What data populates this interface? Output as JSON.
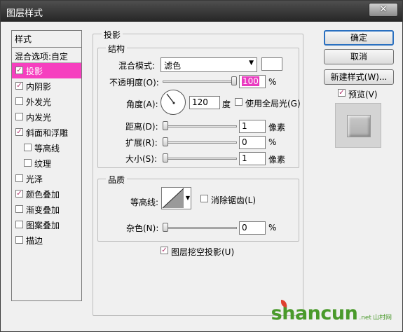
{
  "window": {
    "title": "图层样式",
    "close_glyph": "✕"
  },
  "styles_list": {
    "header": "样式",
    "blend_options": "混合选项:自定",
    "items": [
      {
        "label": "投影",
        "checked": true,
        "selected": true
      },
      {
        "label": "内阴影",
        "checked": true
      },
      {
        "label": "外发光",
        "checked": false
      },
      {
        "label": "内发光",
        "checked": false
      },
      {
        "label": "斜面和浮雕",
        "checked": true
      },
      {
        "label": "等高线",
        "checked": false,
        "sub": true
      },
      {
        "label": "纹理",
        "checked": false,
        "sub": true
      },
      {
        "label": "光泽",
        "checked": false
      },
      {
        "label": "颜色叠加",
        "checked": true
      },
      {
        "label": "渐变叠加",
        "checked": false
      },
      {
        "label": "图案叠加",
        "checked": false
      },
      {
        "label": "描边",
        "checked": false
      }
    ]
  },
  "shadow": {
    "section_title": "投影",
    "structure": {
      "title": "结构",
      "blend_mode_label": "混合模式:",
      "blend_mode_value": "滤色",
      "opacity_label": "不透明度(O):",
      "opacity_value": "100",
      "opacity_unit": "%",
      "opacity_level": 1.0,
      "angle_label": "角度(A):",
      "angle_value": "120",
      "angle_unit": "度",
      "global_light_label": "使用全局光(G)",
      "global_light_checked": false,
      "distance_label": "距离(D):",
      "distance_value": "1",
      "distance_unit": "像素",
      "spread_label": "扩展(R):",
      "spread_value": "0",
      "spread_unit": "%",
      "size_label": "大小(S):",
      "size_value": "1",
      "size_unit": "像素"
    },
    "quality": {
      "title": "品质",
      "contour_label": "等高线:",
      "antialias_label": "消除锯齿(L)",
      "antialias_checked": false,
      "noise_label": "杂色(N):",
      "noise_value": "0",
      "noise_unit": "%"
    },
    "knockout_label": "图层挖空投影(U)",
    "knockout_checked": true
  },
  "buttons": {
    "ok": "确定",
    "cancel": "取消",
    "new_style": "新建样式(W)...",
    "preview_label": "预览(V)",
    "preview_checked": true
  },
  "watermark": {
    "big": "shancun",
    "small": ".net",
    "cn": "山村网"
  },
  "colors": {
    "selected_item": "#f63fbf",
    "titlebar": "#333333",
    "accent_text": "#e93bc0"
  }
}
